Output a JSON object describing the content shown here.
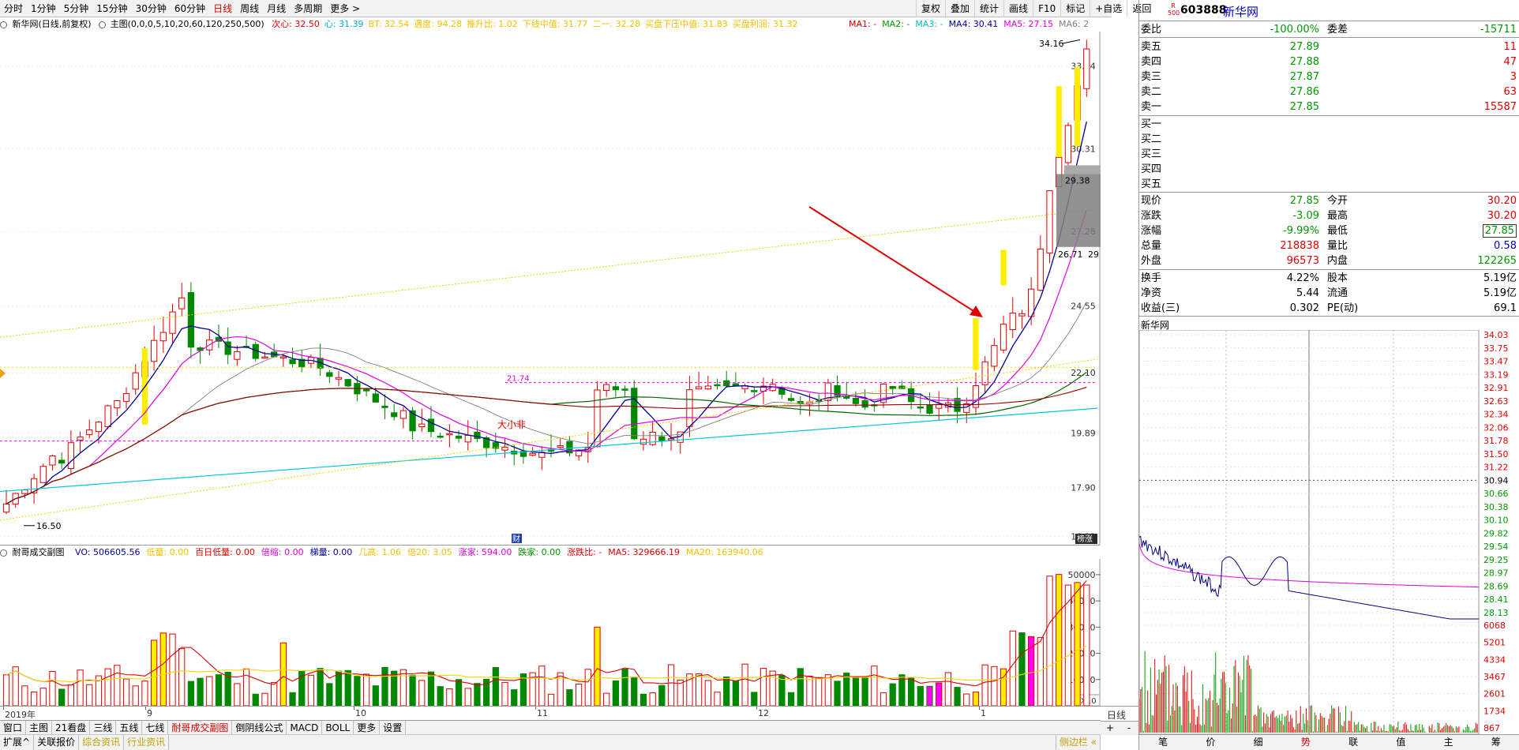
{
  "toolbar": {
    "periods": [
      "分时",
      "1分钟",
      "5分钟",
      "15分钟",
      "30分钟",
      "60分钟",
      "日线",
      "周线",
      "月线",
      "多周期",
      "更多 >"
    ],
    "active_period": "日线",
    "tools": [
      "复权",
      "叠加",
      "统计",
      "画线",
      "F10",
      "标记",
      "+自选",
      "返回"
    ]
  },
  "indicator_row": {
    "stock_label": "新华网(日线,前复权)",
    "main_label": "主图(0,0,0,5,10,20,60,120,250,500)",
    "items": [
      {
        "text": "次心: 32.50",
        "color": "#e00000"
      },
      {
        "text": "心: 31.39",
        "color": "#00b0d0"
      },
      {
        "text": "BT: 32.54",
        "color": "#f0c000"
      },
      {
        "text": "遇度: 94.28",
        "color": "#f0c000"
      },
      {
        "text": "推升比: 1.02",
        "color": "#f0c000"
      },
      {
        "text": "下线中值: 31.77",
        "color": "#f0c000"
      },
      {
        "text": "二一: 32.28",
        "color": "#f0c000"
      },
      {
        "text": "买盘下压中值: 31.83",
        "color": "#f0c000"
      },
      {
        "text": "买盘利润: 31.32",
        "color": "#f0c000"
      }
    ],
    "ma_items": [
      {
        "text": "MA1: -",
        "color": "#cc0000"
      },
      {
        "text": "MA2: -",
        "color": "#009900"
      },
      {
        "text": "MA3: -",
        "color": "#00c0c0"
      },
      {
        "text": "MA4: 30.41",
        "color": "#000099"
      },
      {
        "text": "MA5: 27.15",
        "color": "#e000e0"
      },
      {
        "text": "MA6: 2",
        "color": "#808080"
      }
    ]
  },
  "price_axis": [
    "33.34",
    "30.31",
    "27.28",
    "24.55",
    "22.10",
    "19.89",
    "17.90",
    "16.11"
  ],
  "price_annotations": {
    "high": "34.16",
    "low": "16.50",
    "box_top": "29.38",
    "box_bottom": "26.71",
    "box_side": "29",
    "level": "21.74",
    "note": "大小非",
    "caijing_mark": "财",
    "shortcut": "榜涨"
  },
  "volume_row": {
    "title": "耐哥成交副图",
    "items": [
      {
        "text": "VO: 506605.56",
        "color": "#000099"
      },
      {
        "text": "低量: 0.00",
        "color": "#f0c000"
      },
      {
        "text": "百日低量: 0.00",
        "color": "#e00000"
      },
      {
        "text": "倍缩: 0.00",
        "color": "#e000e0"
      },
      {
        "text": "梯量: 0.00",
        "color": "#000099"
      },
      {
        "text": "几高: 1.06",
        "color": "#f0c000"
      },
      {
        "text": "倍20: 3.05",
        "color": "#f0c000"
      },
      {
        "text": "涨家: 594.00",
        "color": "#e000e0"
      },
      {
        "text": "跌家: 0.00",
        "color": "#009900"
      },
      {
        "text": "涨跌比: -",
        "color": "#e00000"
      },
      {
        "text": "MA5: 329666.19",
        "color": "#e00000"
      },
      {
        "text": "MA20: 163940.06",
        "color": "#f0c000"
      }
    ]
  },
  "volume_axis": [
    "50000",
    "40000",
    "30000",
    "20000",
    "10000"
  ],
  "volume_unit": "X10",
  "date_axis": [
    "2019年",
    "9",
    "10",
    "11",
    "12",
    "1"
  ],
  "date_axis_right": "日线",
  "bottom_tabs_1": [
    "窗口",
    "主图",
    "21看盘",
    "三线",
    "五线",
    "七线",
    "耐哥成交副图",
    "倒阴线公式",
    "MACD",
    "BOLL",
    "更多",
    "设置"
  ],
  "bottom_tabs_1_active": "耐哥成交副图",
  "bottom_tabs_2": [
    "扩展^",
    "关联报价",
    "综合资讯",
    "行业资讯"
  ],
  "right_panel": {
    "code": "603888",
    "name": "新华网",
    "badge_top": "R",
    "badge_bottom": "500",
    "weibi": {
      "label": "委比",
      "value": "-100.00%",
      "label2": "委差",
      "value2": "-15711"
    },
    "sell": [
      {
        "label": "卖五",
        "price": "27.89",
        "vol": "11"
      },
      {
        "label": "卖四",
        "price": "27.88",
        "vol": "47"
      },
      {
        "label": "卖三",
        "price": "27.87",
        "vol": "3"
      },
      {
        "label": "卖二",
        "price": "27.86",
        "vol": "63"
      },
      {
        "label": "卖一",
        "price": "27.85",
        "vol": "15587"
      }
    ],
    "buy": [
      "买一",
      "买二",
      "买三",
      "买四",
      "买五"
    ],
    "stats": [
      {
        "l1": "现价",
        "v1": "27.85",
        "c1": "green",
        "l2": "今开",
        "v2": "30.20",
        "c2": "red"
      },
      {
        "l1": "涨跌",
        "v1": "-3.09",
        "c1": "green",
        "l2": "最高",
        "v2": "30.20",
        "c2": "red"
      },
      {
        "l1": "涨幅",
        "v1": "-9.99%",
        "c1": "green",
        "l2": "最低",
        "v2": "27.85",
        "c2": "green"
      },
      {
        "l1": "总量",
        "v1": "218838",
        "c1": "red",
        "l2": "量比",
        "v2": "0.58",
        "c2": "blue"
      },
      {
        "l1": "外盘",
        "v1": "96573",
        "c1": "red",
        "l2": "内盘",
        "v2": "122265",
        "c2": "green"
      }
    ],
    "stats2": [
      {
        "l1": "换手",
        "v1": "4.22%",
        "l2": "股本",
        "v2": "5.19亿"
      },
      {
        "l1": "净资",
        "v1": "5.44",
        "l2": "流通",
        "v2": "5.19亿"
      },
      {
        "l1": "收益(三)",
        "v1": "0.302",
        "l2": "PE(动)",
        "v2": "69.1"
      }
    ],
    "mini_title": "新华网",
    "mini_axis_red": [
      "34.03",
      "33.75",
      "33.47",
      "33.19",
      "32.91",
      "32.63",
      "32.34",
      "32.06",
      "31.78",
      "31.50",
      "31.22"
    ],
    "mini_axis_mid": "30.94",
    "mini_axis_green": [
      "30.66",
      "30.38",
      "30.10",
      "29.82",
      "29.54",
      "29.25",
      "28.97",
      "28.69",
      "28.41",
      "28.13"
    ],
    "mini_vol_axis": [
      "6068",
      "5201",
      "4334",
      "3467",
      "2601",
      "1734",
      "867"
    ],
    "bottom_tabs": [
      "笔",
      "价",
      "细",
      "势",
      "联",
      "值",
      "主",
      "筹"
    ],
    "bottom_tabs_active": "势",
    "sidebar_hint": "侧边栏 «"
  }
}
